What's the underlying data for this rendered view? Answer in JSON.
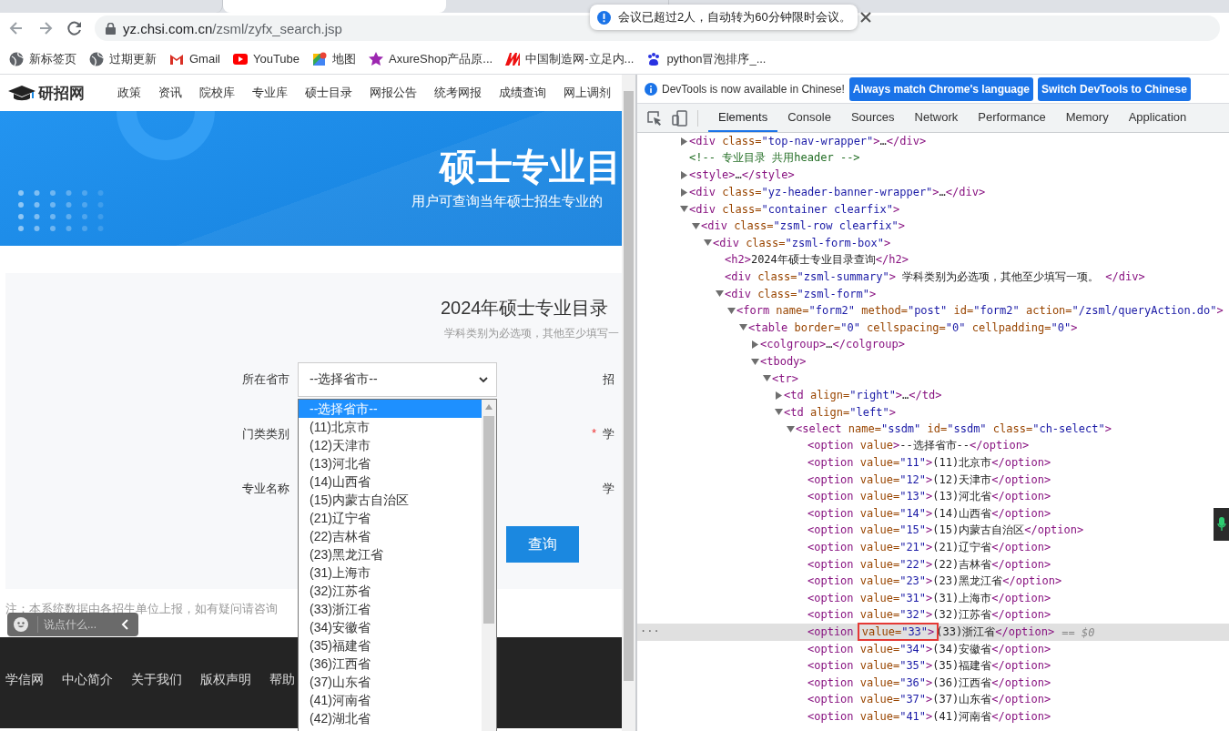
{
  "browser": {
    "tabs": [
      {
        "selected": false
      },
      {
        "selected": true
      },
      {
        "selected": false
      }
    ],
    "address": {
      "host": "yz.chsi.com.cn",
      "path": "/zsml/zyfx_search.jsp"
    },
    "bookmarks": [
      {
        "kind": "globe",
        "label": "新标签页"
      },
      {
        "kind": "globe",
        "label": "过期更新"
      },
      {
        "kind": "gmail",
        "label": "Gmail"
      },
      {
        "kind": "youtube",
        "label": "YouTube"
      },
      {
        "kind": "maps",
        "label": "地图"
      },
      {
        "kind": "star",
        "label": "AxureShop产品原..."
      },
      {
        "kind": "made",
        "label": "中国制造网-立足内..."
      },
      {
        "kind": "paw",
        "label": "python冒泡排序_..."
      }
    ]
  },
  "toast": {
    "message": "会议已超过2人，自动转为60分钟限时会议。"
  },
  "site": {
    "logo": "研招网",
    "nav": [
      "政策",
      "资讯",
      "院校库",
      "专业库",
      "硕士目录",
      "网报公告",
      "统考网报",
      "成绩查询",
      "网上调剂"
    ],
    "banner": {
      "title": "硕士专业目",
      "subtitle": "用户可查询当年硕士招生专业的"
    },
    "form": {
      "heading": "2024年硕士专业目录",
      "summary": "学科类别为必选项，其他至少填写一",
      "rows": [
        {
          "label": "所在省市",
          "field": {
            "value": "--选择省市--",
            "open": true
          },
          "right_label": "招"
        },
        {
          "label": "门类类别",
          "required_mark": "*",
          "right_label": "学"
        },
        {
          "label": "专业名称",
          "right_label": "学"
        }
      ],
      "query_button": "查询",
      "dropdown": [
        {
          "label": "--选择省市--",
          "selected": true
        },
        {
          "label": "(11)北京市",
          "selected": false
        },
        {
          "label": "(12)天津市",
          "selected": false
        },
        {
          "label": "(13)河北省",
          "selected": false
        },
        {
          "label": "(14)山西省",
          "selected": false
        },
        {
          "label": "(15)内蒙古自治区",
          "selected": false
        },
        {
          "label": "(21)辽宁省",
          "selected": false
        },
        {
          "label": "(22)吉林省",
          "selected": false
        },
        {
          "label": "(23)黑龙江省",
          "selected": false
        },
        {
          "label": "(31)上海市",
          "selected": false
        },
        {
          "label": "(32)江苏省",
          "selected": false
        },
        {
          "label": "(33)浙江省",
          "selected": false
        },
        {
          "label": "(34)安徽省",
          "selected": false
        },
        {
          "label": "(35)福建省",
          "selected": false
        },
        {
          "label": "(36)江西省",
          "selected": false
        },
        {
          "label": "(37)山东省",
          "selected": false
        },
        {
          "label": "(41)河南省",
          "selected": false
        },
        {
          "label": "(42)湖北省",
          "selected": false
        }
      ]
    },
    "note": "注：本系统数据由各招生单位上报，如有疑问请咨询",
    "chat": {
      "placeholder": "说点什么..."
    },
    "footer": {
      "links": [
        "学信网",
        "中心简介",
        "关于我们",
        "版权声明",
        "帮助"
      ]
    }
  },
  "devtools": {
    "infobar": {
      "message": "DevTools is now available in Chinese!",
      "buttons": [
        "Always match Chrome's language",
        "Switch DevTools to Chinese"
      ]
    },
    "tabs": [
      {
        "label": "Elements",
        "selected": true
      },
      {
        "label": "Console",
        "selected": false
      },
      {
        "label": "Sources",
        "selected": false
      },
      {
        "label": "Network",
        "selected": false
      },
      {
        "label": "Performance",
        "selected": false
      },
      {
        "label": "Memory",
        "selected": false
      },
      {
        "label": "Application",
        "selected": false
      }
    ],
    "dom_tree": [
      {
        "markup": "<div class=\"top-nav-wrapper\">…</div>",
        "expanded": false,
        "selected": false
      },
      {
        "kind": "comment",
        "markup": "<!-- 专业目录 共用header -->",
        "selected": false
      },
      {
        "markup": "<style>…</style>",
        "expanded": false,
        "selected": false
      },
      {
        "markup": "<div class=\"yz-header-banner-wrapper\">…</div>",
        "expanded": false,
        "selected": false
      },
      {
        "markup": "<div class=\"container clearfix\">",
        "expanded": true,
        "selected": false,
        "children": [
          {
            "markup": "<div class=\"zsml-row clearfix\">",
            "expanded": true,
            "selected": false,
            "children": [
              {
                "markup": "<div class=\"zsml-form-box\">",
                "expanded": true,
                "selected": false,
                "children": [
                  {
                    "markup": "<h2>2024年硕士专业目录查询</h2>",
                    "selected": false
                  },
                  {
                    "markup": "<div class=\"zsml-summary\"> 学科类别为必选项，其他至少填写一项。 </div>",
                    "selected": false
                  },
                  {
                    "markup": "<div class=\"zsml-form\">",
                    "expanded": true,
                    "selected": false,
                    "children": [
                      {
                        "markup": "<form name=\"form2\" method=\"post\" id=\"form2\" action=\"/zsml/queryAction.do\">",
                        "expanded": true,
                        "selected": false,
                        "children": [
                          {
                            "markup": "<table border=\"0\" cellspacing=\"0\" cellpadding=\"0\">",
                            "expanded": true,
                            "selected": false,
                            "children": [
                              {
                                "markup": "<colgroup>…</colgroup>",
                                "expanded": false,
                                "selected": false
                              },
                              {
                                "markup": "<tbody>",
                                "expanded": true,
                                "selected": false,
                                "children": [
                                  {
                                    "markup": "<tr>",
                                    "expanded": true,
                                    "selected": false,
                                    "children": [
                                      {
                                        "markup": "<td align=\"right\">…</td>",
                                        "expanded": false,
                                        "selected": false
                                      },
                                      {
                                        "markup": "<td align=\"left\">",
                                        "expanded": true,
                                        "selected": false,
                                        "children": [
                                          {
                                            "markup": "<select name=\"ssdm\" id=\"ssdm\" class=\"ch-select\">",
                                            "expanded": true,
                                            "selected": false,
                                            "children": [
                                              {
                                                "markup": "<option value>--选择省市--</option>",
                                                "selected": false
                                              },
                                              {
                                                "markup": "<option value=\"11\">(11)北京市</option>",
                                                "selected": false
                                              },
                                              {
                                                "markup": "<option value=\"12\">(12)天津市</option>",
                                                "selected": false
                                              },
                                              {
                                                "markup": "<option value=\"13\">(13)河北省</option>",
                                                "selected": false
                                              },
                                              {
                                                "markup": "<option value=\"14\">(14)山西省</option>",
                                                "selected": false
                                              },
                                              {
                                                "markup": "<option value=\"15\">(15)内蒙古自治区</option>",
                                                "selected": false
                                              },
                                              {
                                                "markup": "<option value=\"21\">(21)辽宁省</option>",
                                                "selected": false
                                              },
                                              {
                                                "markup": "<option value=\"22\">(22)吉林省</option>",
                                                "selected": false
                                              },
                                              {
                                                "markup": "<option value=\"23\">(23)黑龙江省</option>",
                                                "selected": false
                                              },
                                              {
                                                "markup": "<option value=\"31\">(31)上海市</option>",
                                                "selected": false
                                              },
                                              {
                                                "markup": "<option value=\"32\">(32)江苏省</option>",
                                                "selected": false
                                              },
                                              {
                                                "segments": [
                                                  {
                                                    "text": "<option "
                                                  },
                                                  {
                                                    "text": "value=\"33\">",
                                                    "boxed": true
                                                  },
                                                  {
                                                    "text": "(33)浙江省</option>"
                                                  }
                                                ],
                                                "selected": true,
                                                "gutter": "···",
                                                "console_ref": "== $0"
                                              },
                                              {
                                                "markup": "<option value=\"34\">(34)安徽省</option>",
                                                "selected": false
                                              },
                                              {
                                                "markup": "<option value=\"35\">(35)福建省</option>",
                                                "selected": false
                                              },
                                              {
                                                "markup": "<option value=\"36\">(36)江西省</option>",
                                                "selected": false
                                              },
                                              {
                                                "markup": "<option value=\"37\">(37)山东省</option>",
                                                "selected": false
                                              },
                                              {
                                                "markup": "<option value=\"41\">(41)河南省</option>",
                                                "selected": false
                                              }
                                            ]
                                          }
                                        ]
                                      }
                                    ]
                                  }
                                ]
                              }
                            ]
                          }
                        ]
                      }
                    ]
                  }
                ]
              }
            ]
          }
        ]
      }
    ]
  }
}
